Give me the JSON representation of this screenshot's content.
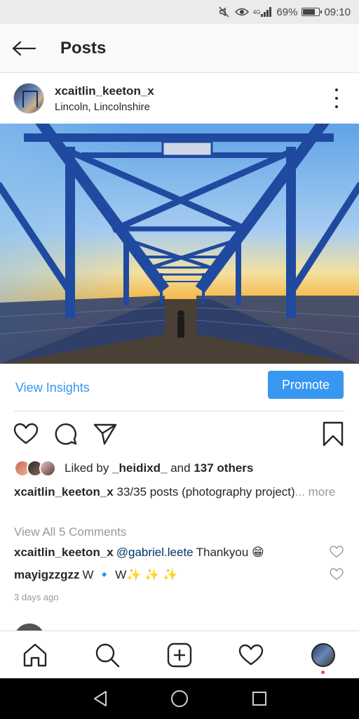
{
  "status_bar": {
    "network": "4G",
    "battery_percent": "69%",
    "battery_level": 0.69,
    "time": "09:10",
    "icons": [
      "mute-icon",
      "eye-icon",
      "signal-icon",
      "battery-icon"
    ]
  },
  "header": {
    "title": "Posts",
    "back_icon": "arrow-left-icon"
  },
  "post": {
    "username": "xcaitlin_keeton_x",
    "location": "Lincoln, Lincolnshire",
    "view_insights_label": "View Insights",
    "promote_label": "Promote",
    "likes": {
      "prefix": "Liked by",
      "first_liker": "_heidixd_",
      "connector": "and",
      "others": "137 others"
    },
    "caption": {
      "username": "xcaitlin_keeton_x",
      "text": "33/35 posts (photography project)",
      "more_label": "... more"
    },
    "view_all_comments_label": "View All 5 Comments",
    "comments": [
      {
        "username": "xcaitlin_keeton_x",
        "mention": "@gabriel.leete",
        "text": "Thankyou 😁"
      },
      {
        "username": "mayigzzgzz",
        "text": "W 🔹 W✨ ✨ ✨"
      }
    ],
    "timestamp": "3 days ago"
  },
  "bottom_nav": {
    "items": [
      "home-icon",
      "search-icon",
      "add-post-icon",
      "activity-heart-icon",
      "profile-avatar"
    ]
  },
  "colors": {
    "accent": "#3897f0",
    "mention": "#003569",
    "muted": "#999999",
    "notification_dot": "#ed4956"
  }
}
